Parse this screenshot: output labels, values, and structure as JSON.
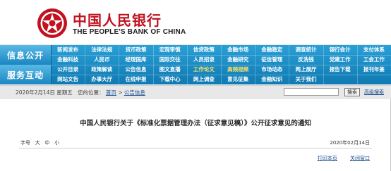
{
  "header": {
    "bank_name_cn": "中国人民银行",
    "bank_name_en": "THE PEOPLE'S BANK OF CHINA",
    "brand_red": "#c1121f",
    "logo": "pboc-emblem"
  },
  "nav": {
    "sections": [
      "信息公开",
      "服务互动"
    ],
    "rows": [
      [
        "新闻发布",
        "法律法规",
        "货币政策",
        "宏观审慎",
        "信贷政策",
        "金融市场",
        "金融稳定",
        "调查统计",
        "银行会计",
        "支付体系"
      ],
      [
        "金融科技",
        "人民币",
        "经理国库",
        "国际交往",
        "人员招录",
        "金融研究",
        "征信管理",
        "反洗钱",
        "党建工作",
        "工会工作"
      ],
      [
        "公开目录",
        "政策解读",
        "公告信息",
        "图文直播",
        "工作论文",
        "高频视频",
        "市场动态",
        "网上展厅",
        "报告下载",
        "报刊年鉴"
      ],
      [
        "网站文告",
        "办事大厅",
        "在线申报",
        "下载中心",
        "网上调查",
        "意见征集",
        "金融知识",
        "关于我们",
        "",
        ""
      ]
    ],
    "highlight_color": "#ffe36a"
  },
  "breadcrumb": {
    "date_text": "2020年2月14日 星期五",
    "location_label": "您的位置：",
    "home": "首页",
    "separator": " > ",
    "current": "公告信息"
  },
  "search": {
    "placeholder": "",
    "button_label": "搜索",
    "advanced_label": "高级搜索"
  },
  "article": {
    "title": "中国人民银行关于《标准化票据管理办法（征求意见稿）》公开征求意见的通知",
    "size_label": "字号",
    "sizes": [
      "大",
      "中",
      "小"
    ],
    "date": "2020年02月14日"
  },
  "footer": {
    "print": "打印本页",
    "close": "关闭窗口"
  }
}
